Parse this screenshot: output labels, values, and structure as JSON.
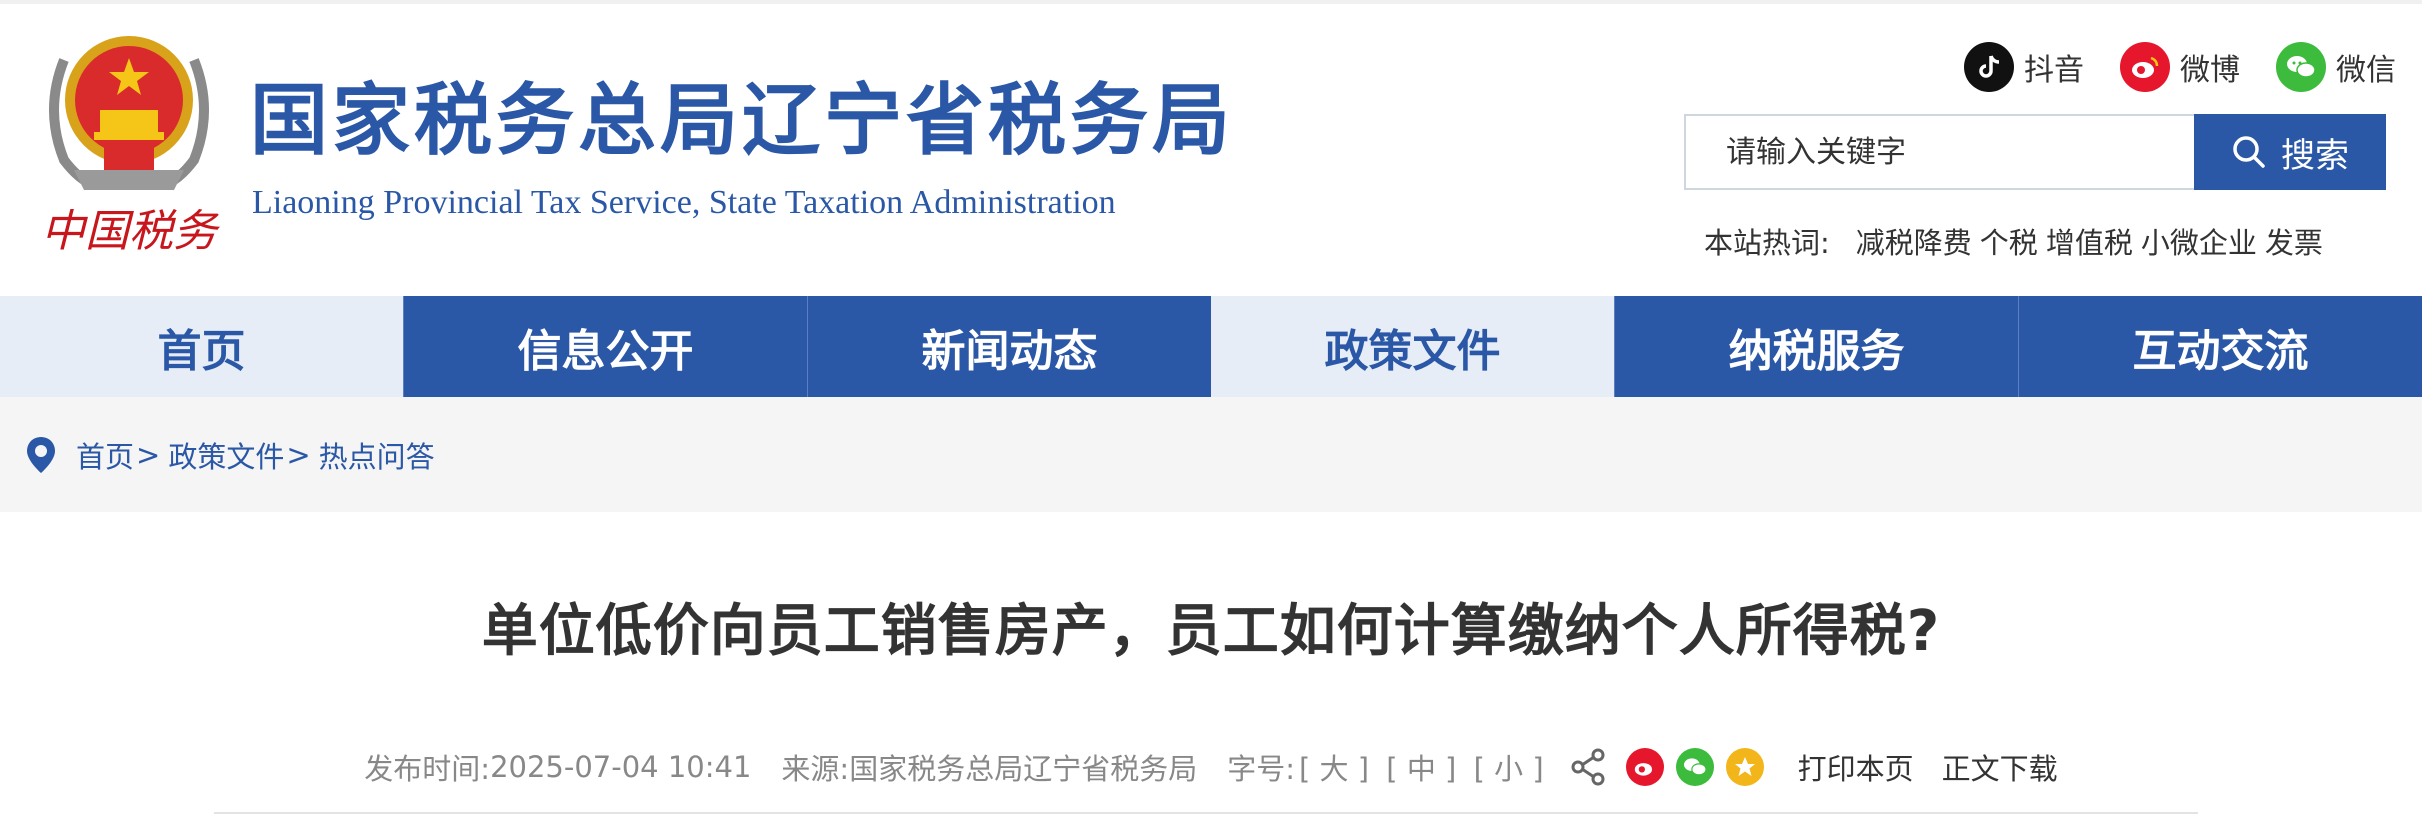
{
  "header": {
    "title": "国家税务总局辽宁省税务局",
    "subtitle": "Liaoning Provincial Tax Service, State Taxation Administration",
    "emblem_text": "中国税务",
    "socials": [
      {
        "label": "抖音",
        "icon": "douyin-icon"
      },
      {
        "label": "微博",
        "icon": "weibo-icon"
      },
      {
        "label": "微信",
        "icon": "wechat-icon"
      }
    ],
    "search": {
      "placeholder": "请输入关键字",
      "button_label": "搜索"
    },
    "hotwords": {
      "label": "本站热词:",
      "items": [
        "减税降费",
        "个税",
        "增值税",
        "小微企业",
        "发票"
      ]
    }
  },
  "nav": {
    "items": [
      {
        "label": "首页"
      },
      {
        "label": "信息公开"
      },
      {
        "label": "新闻动态"
      },
      {
        "label": "政策文件"
      },
      {
        "label": "纳税服务"
      },
      {
        "label": "互动交流"
      }
    ]
  },
  "breadcrumb": {
    "items": [
      "首页",
      "政策文件",
      "热点问答"
    ],
    "separator": ">"
  },
  "article": {
    "title": "单位低价向员工销售房产，员工如何计算缴纳个人所得税?",
    "meta": {
      "publish_label": "发布时间:",
      "publish_time": "2025-07-04 10:41",
      "source_label": "来源:",
      "source": "国家税务总局辽宁省税务局",
      "font_label": "字号:",
      "font_sizes": [
        "[ 大 ]",
        "[ 中 ]",
        "[ 小 ]"
      ],
      "print_label": "打印本页",
      "download_label": "正文下载"
    }
  },
  "colors": {
    "brand_blue": "#2a57a6",
    "nav_light": "#e7edf6",
    "weibo_red": "#e6162d",
    "wechat_green": "#3cbb3c",
    "favorite_gold": "#f2b51a"
  }
}
